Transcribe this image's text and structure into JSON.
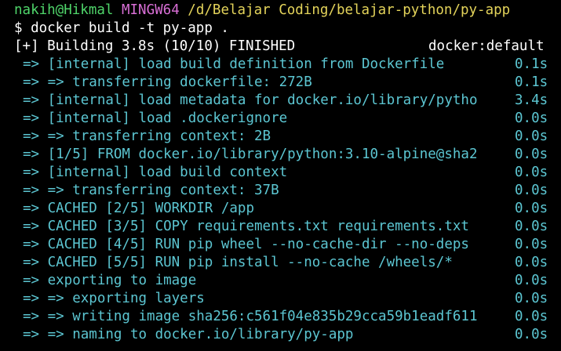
{
  "prompt": {
    "user": "nakih@Hikmal",
    "shell": "MINGW64",
    "path": "/d/Belajar Coding/belajar-python/py-app"
  },
  "command": "$ docker build -t py-app .",
  "status": {
    "left": "[+] Building 3.8s (10/10) FINISHED",
    "right": "docker:default"
  },
  "steps": [
    {
      "text": "=> [internal] load build definition from Dockerfile",
      "time": "0.1s"
    },
    {
      "text": "=> => transferring dockerfile: 272B",
      "time": "0.1s"
    },
    {
      "text": "=> [internal] load metadata for docker.io/library/pytho",
      "time": "3.4s"
    },
    {
      "text": "=> [internal] load .dockerignore",
      "time": "0.0s"
    },
    {
      "text": "=> => transferring context: 2B",
      "time": "0.0s"
    },
    {
      "text": "=> [1/5] FROM docker.io/library/python:3.10-alpine@sha2",
      "time": "0.0s"
    },
    {
      "text": "=> [internal] load build context",
      "time": "0.0s"
    },
    {
      "text": "=> => transferring context: 37B",
      "time": "0.0s"
    },
    {
      "text": "=> CACHED [2/5] WORKDIR /app",
      "time": "0.0s"
    },
    {
      "text": "=> CACHED [3/5] COPY requirements.txt requirements.txt",
      "time": "0.0s"
    },
    {
      "text": "=> CACHED [4/5] RUN pip wheel --no-cache-dir --no-deps",
      "time": "0.0s"
    },
    {
      "text": "=> CACHED [5/5] RUN pip install --no-cache /wheels/*",
      "time": "0.0s"
    },
    {
      "text": "=> exporting to image",
      "time": "0.0s"
    },
    {
      "text": "=> => exporting layers",
      "time": "0.0s"
    },
    {
      "text": "=> => writing image sha256:c561f04e835b29cca59b1eadf611",
      "time": "0.0s"
    },
    {
      "text": "=> => naming to docker.io/library/py-app",
      "time": "0.0s"
    }
  ],
  "colors": {
    "background": "#000000",
    "user": "#4fd56a",
    "shell": "#d96fd6",
    "path": "#e3d35a",
    "step": "#5cc6d2",
    "text": "#ffffff"
  }
}
